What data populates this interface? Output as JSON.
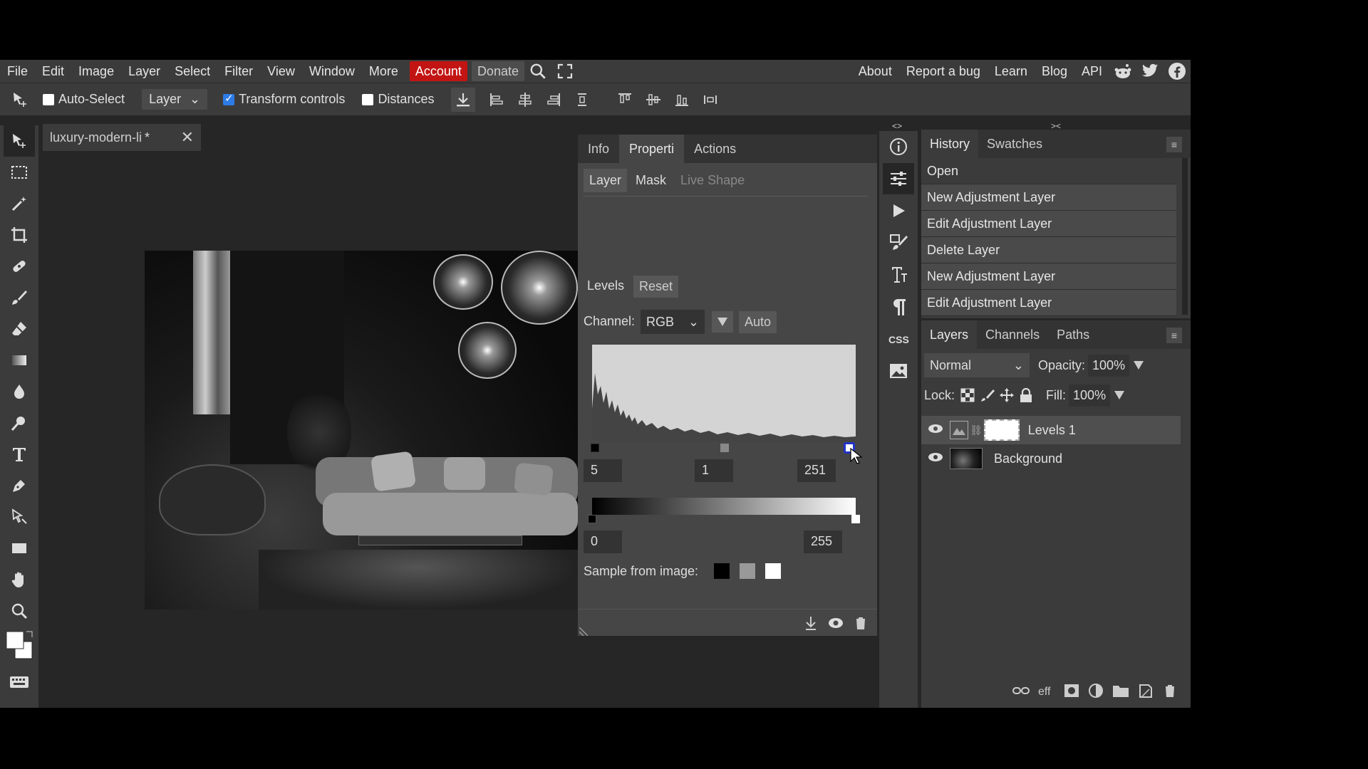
{
  "menubar": {
    "items": [
      "File",
      "Edit",
      "Image",
      "Layer",
      "Select",
      "Filter",
      "View",
      "Window",
      "More"
    ],
    "account": "Account",
    "donate": "Donate",
    "right_items": [
      "About",
      "Report a bug",
      "Learn",
      "Blog",
      "API"
    ],
    "icons": [
      "search-icon",
      "fullscreen-icon",
      "reddit-icon",
      "twitter-icon",
      "facebook-icon"
    ]
  },
  "toolbar": {
    "auto_select_label": "Auto-Select",
    "auto_select_checked": false,
    "layer_select_value": "Layer",
    "transform_controls_label": "Transform controls",
    "transform_controls_checked": true,
    "distances_label": "Distances",
    "distances_checked": false
  },
  "document_tab": {
    "title": "luxury-modern-li",
    "modified": "*",
    "close": "✕"
  },
  "properties": {
    "tabs": [
      "Info",
      "Properti",
      "Actions"
    ],
    "active_tab": "Properti",
    "subtabs": [
      "Layer",
      "Mask",
      "Live Shape"
    ],
    "levels_label": "Levels",
    "reset_label": "Reset",
    "channel_label": "Channel:",
    "channel_value": "RGB",
    "auto_label": "Auto",
    "input_black": "5",
    "input_gamma": "1",
    "input_white": "251",
    "output_black": "0",
    "output_white": "255",
    "sample_label": "Sample from image:"
  },
  "history": {
    "tabs": [
      "History",
      "Swatches"
    ],
    "items": [
      "Open",
      "New Adjustment Layer",
      "Edit Adjustment Layer",
      "Delete Layer",
      "New Adjustment Layer",
      "Edit Adjustment Layer"
    ]
  },
  "layers": {
    "tabs": [
      "Layers",
      "Channels",
      "Paths"
    ],
    "blend_mode": "Normal",
    "opacity_label": "Opacity:",
    "opacity_value": "100%",
    "lock_label": "Lock:",
    "fill_label": "Fill:",
    "fill_value": "100%",
    "items": [
      {
        "name": "Levels 1",
        "selected": true
      },
      {
        "name": "Background",
        "selected": false
      }
    ]
  },
  "colors": {
    "accent": "#2d7be5",
    "account_bg": "#c31414",
    "panel": "#3b3b3b",
    "workspace": "#262626"
  }
}
